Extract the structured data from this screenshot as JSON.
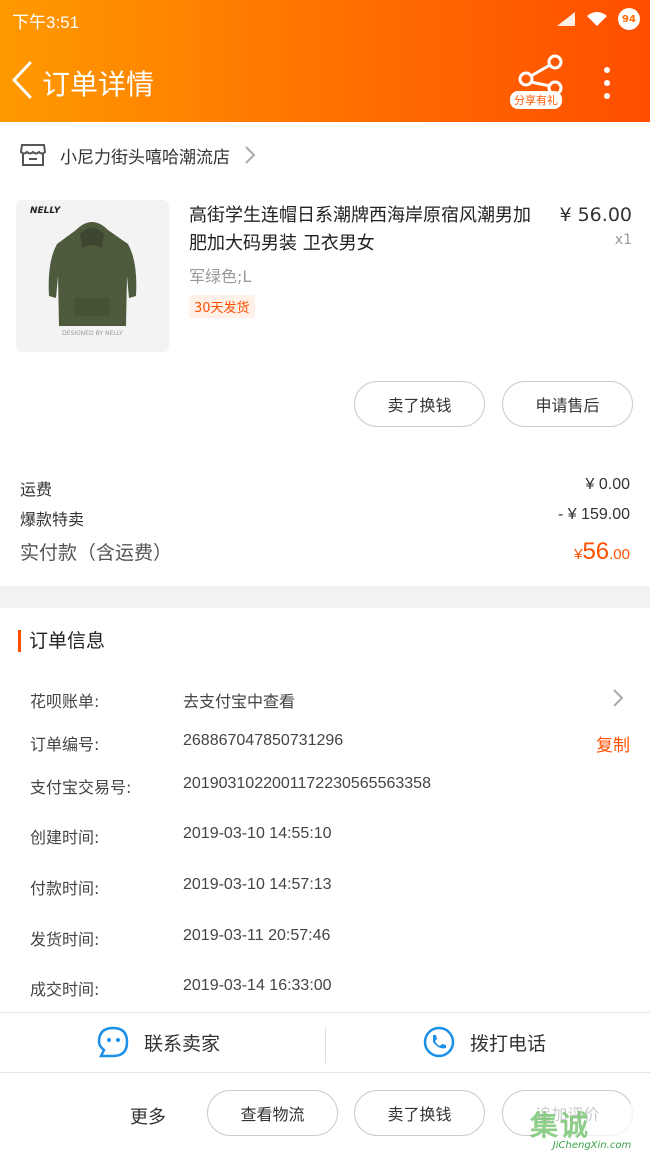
{
  "status_bar": {
    "time": "下午3:51",
    "battery": "94"
  },
  "header": {
    "title": "订单详情",
    "share_label": "分享有礼"
  },
  "shop": {
    "name": "小尼力街头嘻哈潮流店"
  },
  "product": {
    "image_brand": "NELLY",
    "image_footer": "DESIGNED BY NELLY",
    "title": "高街学生连帽日系潮牌西海岸原宿风潮男加肥加大码男装 卫衣男女",
    "price": "¥ 56.00",
    "qty": "x1",
    "sku": "军绿色;L",
    "tag": "30天发货"
  },
  "item_actions": {
    "sell": "卖了换钱",
    "after_sale": "申请售后"
  },
  "fees": {
    "shipping_label": "运费",
    "shipping_value": "¥ 0.00",
    "discount_label": "爆款特卖",
    "discount_value": "- ¥ 159.00",
    "total_label": "实付款（含运费）",
    "total_currency": "¥",
    "total_int": "56",
    "total_dec": ".00"
  },
  "order_info": {
    "heading": "订单信息",
    "rows": [
      {
        "label": "花呗账单:",
        "value": "去支付宝中查看"
      },
      {
        "label": "订单编号:",
        "value": "268867047850731296"
      },
      {
        "label": "支付宝交易号:",
        "value": "2019031022001172230565563358"
      },
      {
        "label": "创建时间:",
        "value": "2019-03-10 14:55:10"
      },
      {
        "label": "付款时间:",
        "value": "2019-03-10 14:57:13"
      },
      {
        "label": "发货时间:",
        "value": "2019-03-11 20:57:46"
      },
      {
        "label": "成交时间:",
        "value": "2019-03-14 16:33:00"
      }
    ],
    "copy_label": "复制"
  },
  "contact": {
    "seller": "联系卖家",
    "phone": "拨打电话"
  },
  "bottom_bar": {
    "more": "更多",
    "logistics": "查看物流",
    "sell": "卖了换钱",
    "review": "追加评价"
  },
  "watermark": {
    "logo_text": "集诚",
    "url": "JiChengXin.com"
  },
  "colors": {
    "accent": "#ff5000",
    "header_start": "#ff9a00",
    "header_end": "#ff4e00"
  }
}
